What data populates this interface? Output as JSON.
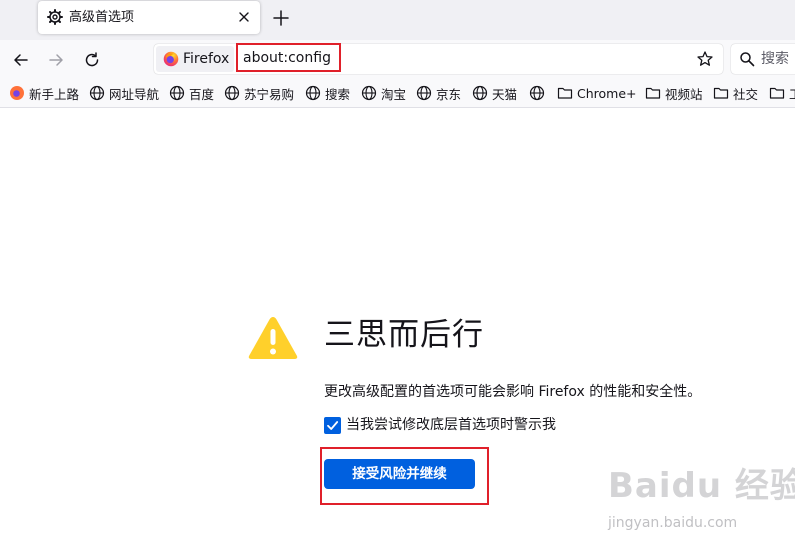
{
  "tab": {
    "title": "高级首选项"
  },
  "urlbar": {
    "identity_label": "Firefox",
    "url": "about:config"
  },
  "searchbar": {
    "label": "搜索"
  },
  "bookmarks": [
    {
      "label": "新手上路",
      "icon": "firefox-icon"
    },
    {
      "label": "网址导航",
      "icon": "globe-icon"
    },
    {
      "label": "百度",
      "icon": "globe-icon"
    },
    {
      "label": "苏宁易购",
      "icon": "globe-icon"
    },
    {
      "label": "搜索",
      "icon": "globe-icon"
    },
    {
      "label": "淘宝",
      "icon": "globe-icon"
    },
    {
      "label": "京东",
      "icon": "globe-icon"
    },
    {
      "label": "天猫",
      "icon": "globe-icon"
    },
    {
      "label": "",
      "icon": "globe-icon"
    },
    {
      "label": "Chrome+",
      "icon": "folder-icon"
    },
    {
      "label": "视频站",
      "icon": "folder-icon"
    },
    {
      "label": "社交",
      "icon": "folder-icon"
    },
    {
      "label": "工",
      "icon": "folder-icon"
    }
  ],
  "warning": {
    "title": "三思而后行",
    "description": "更改高级配置的首选项可能会影响 Firefox 的性能和安全性。",
    "checkbox_label": "当我尝试修改底层首选项时警示我",
    "checkbox_checked": true,
    "accept_button": "接受风险并继续"
  },
  "watermark": {
    "logo": "Baidu 经验",
    "sub": "jingyan.baidu.com"
  },
  "colors": {
    "accent": "#0060df",
    "highlight": "#e0202a",
    "warning": "#ffd02b"
  }
}
